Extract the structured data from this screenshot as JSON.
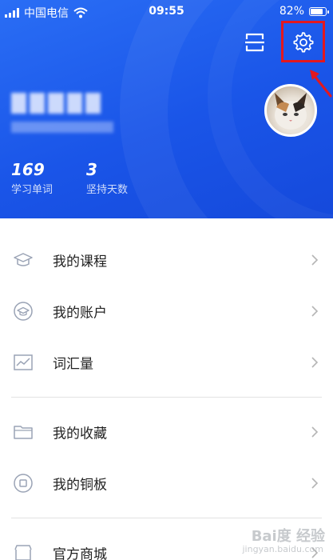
{
  "status_bar": {
    "carrier": "中国电信",
    "time": "09:55",
    "battery": "82%",
    "battery_level": 0.82
  },
  "profile": {
    "stats": [
      {
        "value": "169",
        "label": "学习单词"
      },
      {
        "value": "3",
        "label": "坚持天数"
      }
    ]
  },
  "icons": {
    "scan": "scan-icon",
    "settings": "gear-icon",
    "annotation": "red-arrow-icon"
  },
  "colors": {
    "header": "#1a55e8",
    "highlight": "#e3181e",
    "icon_gray": "#9aa3b5"
  },
  "menu": {
    "items": [
      {
        "label": "我的课程",
        "icon": "graduation-cap-icon"
      },
      {
        "label": "我的账户",
        "icon": "account-cap-icon"
      },
      {
        "label": "词汇量",
        "icon": "chart-icon"
      },
      {
        "label": "我的收藏",
        "icon": "folder-icon"
      },
      {
        "label": "我的铜板",
        "icon": "coin-icon"
      },
      {
        "label": "官方商城",
        "icon": "store-icon"
      }
    ]
  },
  "watermark": {
    "brand": "Bai度 经验",
    "url": "jingyan.baidu.com"
  }
}
